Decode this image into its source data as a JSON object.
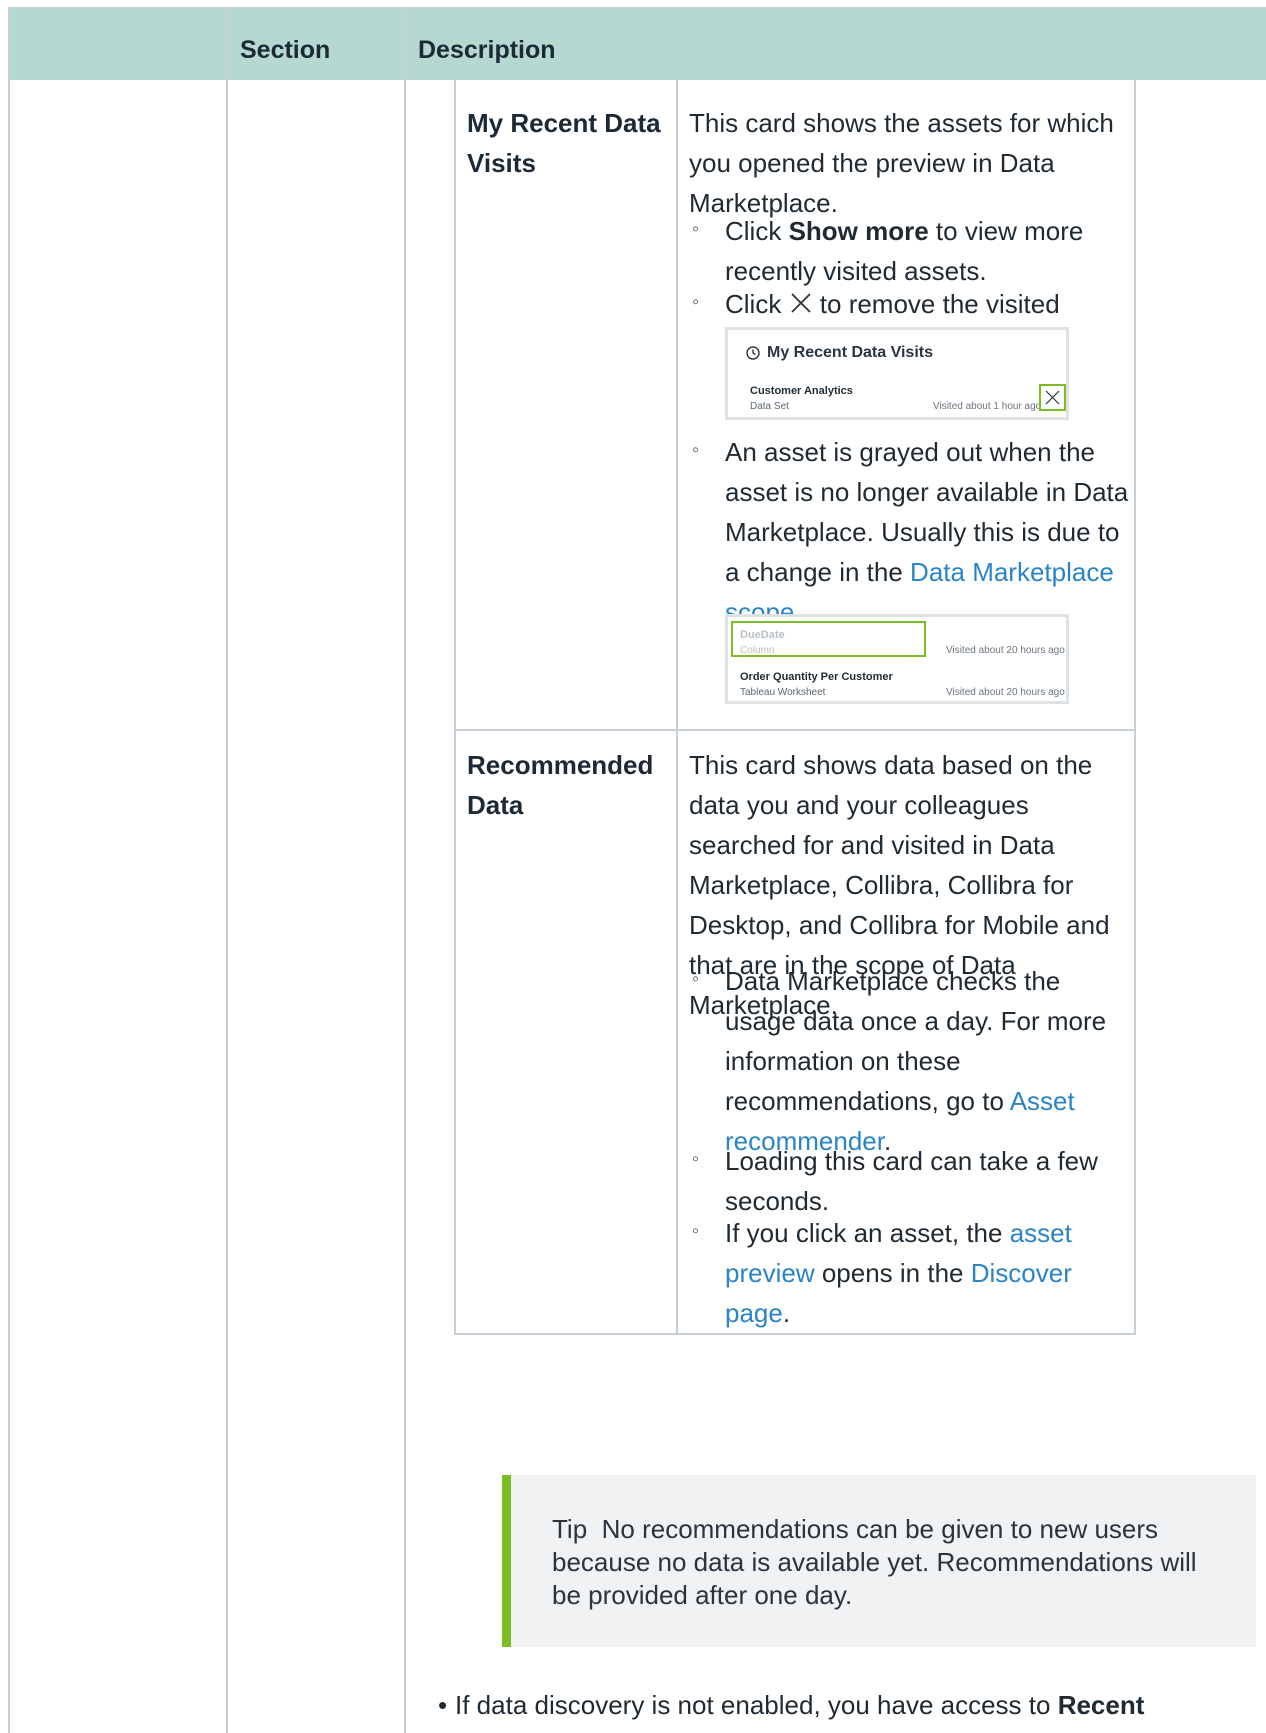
{
  "header": {
    "col_section": "Section",
    "col_description": "Description"
  },
  "recent_visits": {
    "title": "My Recent Data Visits",
    "intro": "This card shows the assets for which you opened the preview in Data Marketplace.",
    "bullet1_pre": "Click ",
    "bullet1_bold": "Show more",
    "bullet1_post": " to view more recently visited assets.",
    "bullet2_pre": "Click ",
    "bullet2_post": " to remove the visited asset.",
    "bullet3_text": "An asset is grayed out when the asset is no longer available in Data Marketplace. Usually this is due to a change in the ",
    "bullet3_link": "Data Marketplace scope",
    "bullet3_end": ".",
    "shot1": {
      "title": "My Recent Data Visits",
      "item_name": "Customer Analytics",
      "item_type": "Data Set",
      "item_time": "Visited about 1 hour ago"
    },
    "shot2": {
      "row1_name": "DueDate",
      "row1_type": "Column",
      "row1_time": "Visited about 20 hours ago",
      "row2_name": "Order Quantity Per Customer",
      "row2_type": "Tableau Worksheet",
      "row2_time": "Visited about 20 hours ago"
    }
  },
  "recommended": {
    "title": "Recommended Data",
    "intro": "This card shows data based on the data you and your colleagues searched for and visited in Data Marketplace, Collibra, Collibra for Desktop, and Collibra for Mobile and that are in the scope of Data Marketplace.",
    "b1_text": "Data Marketplace checks the usage data once a day. For more information on these recommendations, go to ",
    "b1_link": "Asset recommender",
    "b1_end": ".",
    "b2_text": "Loading this card can take a few seconds.",
    "b3_pre": "If you click an asset, the ",
    "b3_link1": "asset preview",
    "b3_mid": " opens in the ",
    "b3_link2": "Discover page",
    "b3_end": "."
  },
  "tip": {
    "label": "Tip",
    "text": "No recommendations can be given to new users because no data is available yet. Recommendations will be provided after one day."
  },
  "footer_bullet": {
    "text": "If data discovery is not enabled, you have access to ",
    "bold": "Recent"
  },
  "colors": {
    "header_bg": "#b5d8d0",
    "link": "#2b84c6",
    "tip_accent": "#7cbd26",
    "highlight": "#7cbd26"
  }
}
